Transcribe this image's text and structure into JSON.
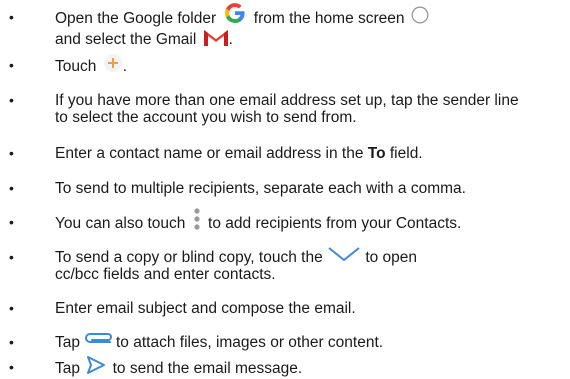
{
  "items": [
    {
      "t1": "Open the Google folder",
      "icon_a": "google-g-icon",
      "t2": "from the home screen",
      "icon_b": "home-circle-icon",
      "t3": "and select the Gmail",
      "icon_c": "gmail-icon",
      "t4": "."
    },
    {
      "t1": "Touch",
      "icon_a": "plus-icon",
      "t2": "."
    },
    {
      "t1": "If you have more than one email address set up, tap the sender line to select the account you wish to send from."
    },
    {
      "t1": "Enter a contact name or email address in the",
      "bold": "To",
      "t2": "field."
    },
    {
      "t1": "To send to multiple recipients, separate each with a comma."
    },
    {
      "t1": "You can also touch",
      "icon_a": "more-vertical-icon",
      "t2": "to add recipients from your Contacts."
    },
    {
      "t1": "To send a copy or blind copy, touch the",
      "icon_a": "chevron-down-icon",
      "t2": "to open",
      "t3": "cc/bcc fields and enter contacts."
    },
    {
      "t1": "Enter email subject and compose the email."
    },
    {
      "t1": "Tap",
      "icon_a": "paperclip-icon",
      "t2": "to attach files, images or other content."
    },
    {
      "t1": "Tap",
      "icon_a": "send-icon",
      "t2": "to send the email message."
    }
  ],
  "bullet_char": "•",
  "colors": {
    "text": "#1a1a1a",
    "google_blue": "#4285F4",
    "google_red": "#EA4335",
    "google_yellow": "#FBBC05",
    "google_green": "#34A853",
    "plus_orange": "#F39C3A",
    "icon_gray": "#9a9a9a",
    "icon_blue": "#3d8ad8"
  }
}
